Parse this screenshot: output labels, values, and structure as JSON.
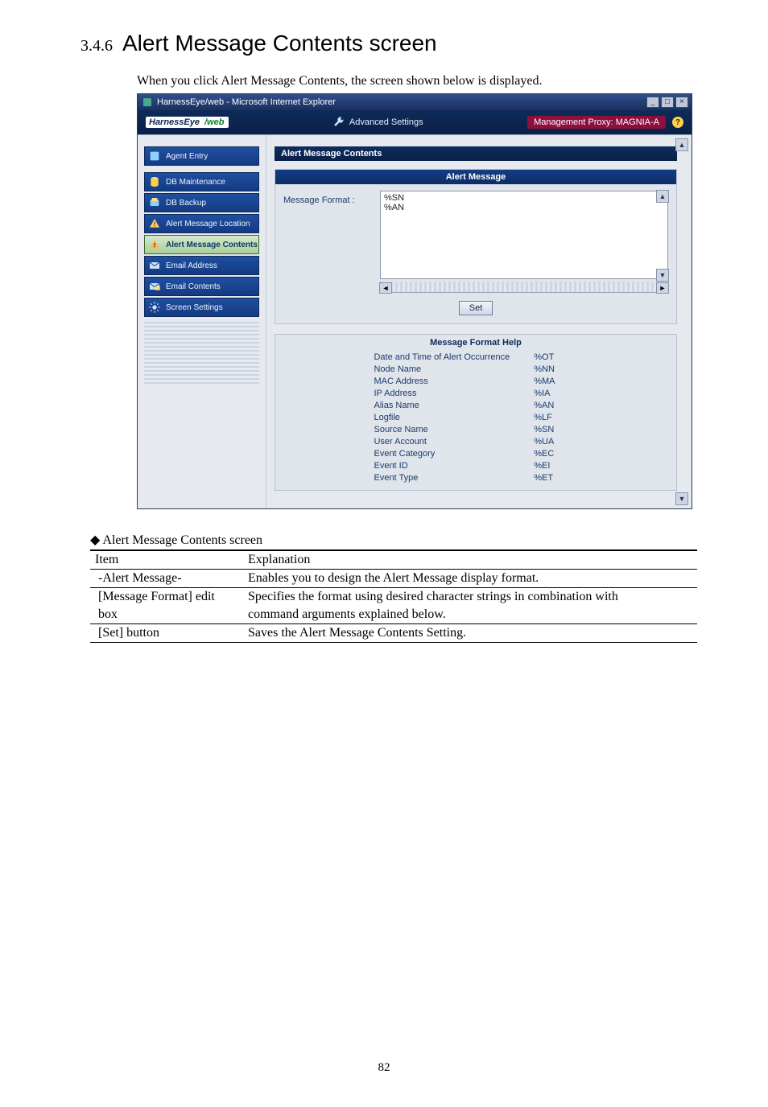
{
  "heading": {
    "num": "3.4.6",
    "text": "Alert Message Contents screen"
  },
  "intro": "When you click Alert Message Contents, the screen shown below is displayed.",
  "window": {
    "title": "HarnessEye/web - Microsoft Internet Explorer",
    "buttons": {
      "min": "_",
      "max": "□",
      "close": "×"
    },
    "brand": {
      "name_main": "HarnessEye",
      "name_sub": "/web",
      "tool": "Advanced Settings",
      "proxy_label": "Management Proxy: MAGNIA-A",
      "help": "?"
    },
    "sidebar": [
      {
        "label": "Agent Entry"
      },
      {
        "label": "DB Maintenance"
      },
      {
        "label": "DB Backup"
      },
      {
        "label": "Alert Message Location"
      },
      {
        "label": "Alert Message Contents",
        "active": true
      },
      {
        "label": "Email Address"
      },
      {
        "label": "Email Contents"
      },
      {
        "label": "Screen Settings"
      }
    ],
    "content": {
      "banner": "Alert Message Contents",
      "panel_head": "Alert Message",
      "form_label": "Message Format :",
      "textarea_value": "%SN\n%AN",
      "set_button": "Set",
      "help_head": "Message Format Help",
      "help_rows": [
        {
          "name": "Date and Time of Alert Occurrence",
          "code": "%OT"
        },
        {
          "name": "Node Name",
          "code": "%NN"
        },
        {
          "name": "MAC Address",
          "code": "%MA"
        },
        {
          "name": "IP Address",
          "code": "%IA"
        },
        {
          "name": "Alias Name",
          "code": "%AN"
        },
        {
          "name": "Logfile",
          "code": "%LF"
        },
        {
          "name": "Source Name",
          "code": "%SN"
        },
        {
          "name": "User Account",
          "code": "%UA"
        },
        {
          "name": "Event Category",
          "code": "%EC"
        },
        {
          "name": "Event ID",
          "code": "%EI"
        },
        {
          "name": "Event Type",
          "code": "%ET"
        }
      ]
    }
  },
  "explain": {
    "caption": "◆ Alert Message Contents screen",
    "head_item": "Item",
    "head_exp": "Explanation",
    "rows": [
      {
        "item": "-Alert Message-",
        "exp": "Enables you to design the Alert Message display format."
      },
      {
        "item": "[Message Format] edit",
        "exp": "Specifies the format using desired character strings in combination with"
      },
      {
        "item": "box",
        "exp": "command arguments explained below.",
        "indent": true
      },
      {
        "item": "[Set] button",
        "exp": "Saves the Alert Message Contents Setting."
      }
    ]
  },
  "page_number": "82"
}
